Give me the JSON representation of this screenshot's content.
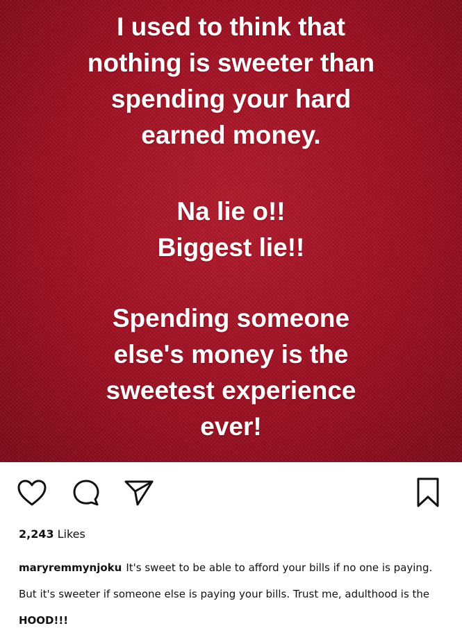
{
  "post": {
    "image_text": {
      "block1": [
        "I used to think that",
        "nothing is sweeter than",
        "spending your hard",
        "earned money."
      ],
      "block2": [
        "Na lie o!!",
        "Biggest lie!!"
      ],
      "block3": [
        "Spending someone",
        "else's money is the",
        "sweetest experience",
        "ever!"
      ]
    },
    "background_color": "#9c0f22",
    "text_color": "#ffffff"
  },
  "actions": {
    "like_icon": "heart-outline-icon",
    "comment_icon": "speech-bubble-icon",
    "share_icon": "paper-plane-icon",
    "save_icon": "bookmark-icon"
  },
  "likes": {
    "count": "2,243",
    "unit": "Likes"
  },
  "caption": {
    "username": "maryremmynjoku",
    "text": "It's sweet to be able to afford your bills if no one is paying. But it's sweeter if someone else is paying your bills. Trust me, adulthood is the",
    "emphasis": "HOOD!!!"
  }
}
